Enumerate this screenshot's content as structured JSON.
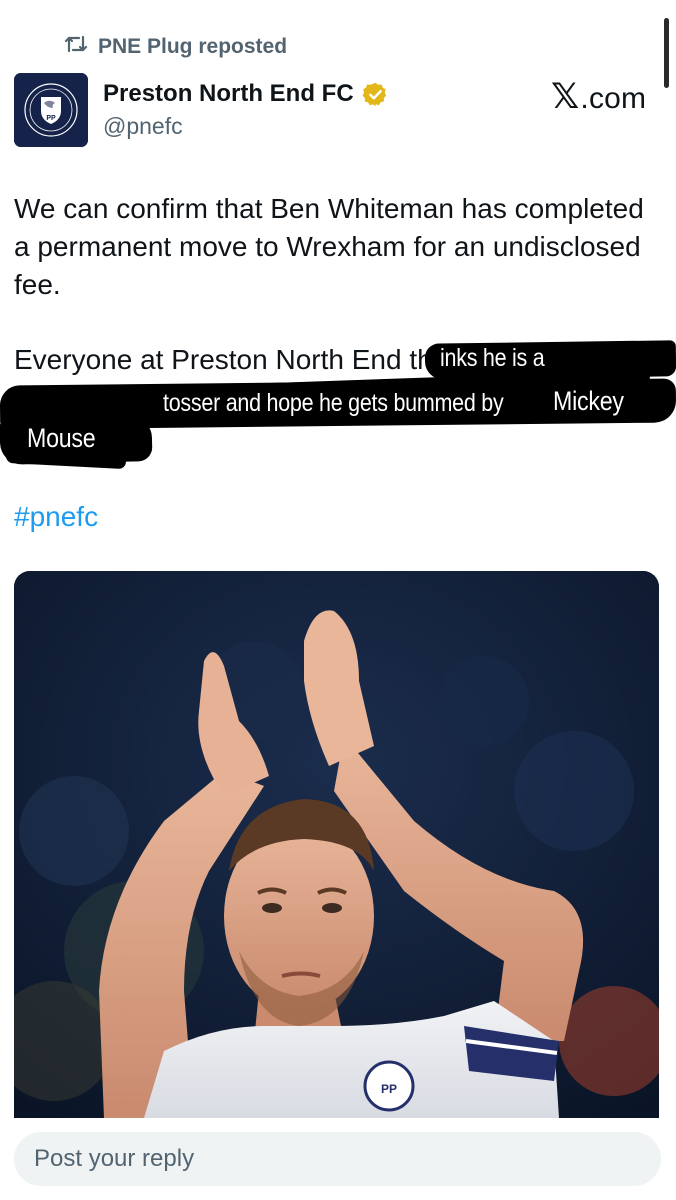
{
  "repost": {
    "icon": "repost-icon",
    "text": "PNE Plug reposted"
  },
  "author": {
    "name": "Preston North End FC",
    "handle": "@pnefc",
    "verified_icon": "verified-badge-icon",
    "avatar": "pnefc-crest-logo",
    "avatar_lettering": "PP"
  },
  "brand": {
    "glyph": "𝕏",
    "suffix": ".com"
  },
  "tweet": {
    "paragraph1": "We can confirm that Ben Whiteman has completed a permanent move to Wrexham for an undisclosed fee.",
    "paragraph2_visible": "Everyone at Preston North End th",
    "scribble_line1": "inks he is a",
    "scribble_line2": "tosser and hope he gets bummed by",
    "scribble_line2b": "Mickey",
    "scribble_line3": "Mouse",
    "hashtag": "#pnefc"
  },
  "media": {
    "description_icon": "player-applauding-photo",
    "kit_crest_lettering": "PP"
  },
  "reply": {
    "placeholder": "Post your reply"
  },
  "colors": {
    "link": "#1d9bf0",
    "secondary_text": "#536471",
    "verified_gold": "#e2b719",
    "crest_navy": "#15234a"
  }
}
